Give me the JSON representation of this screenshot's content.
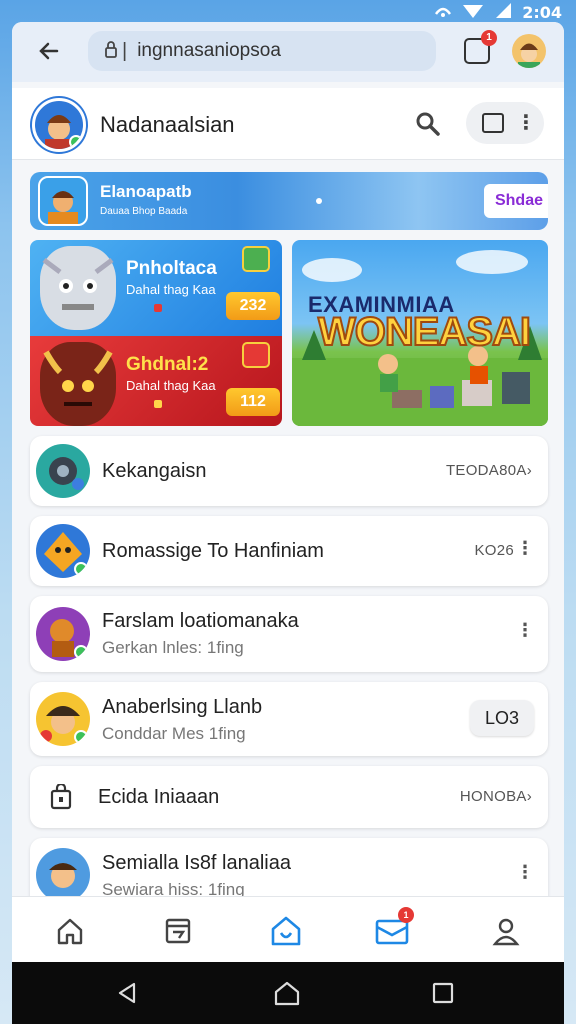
{
  "status_bar": {
    "time": "2:04"
  },
  "browser": {
    "url": "ingnnasaniopsoa",
    "tabs_badge": "1"
  },
  "header": {
    "title": "Nadanaalsian"
  },
  "promo": {
    "title": "Elanoapatb",
    "subtitle": "Dauaa Bhop Baada",
    "button": "Shdae"
  },
  "cards": [
    {
      "title": "Pnholtaca",
      "subtitle": "Dahal thag Kaa",
      "price": "232"
    },
    {
      "title": "Ghdnal:2",
      "subtitle": "Dahal thag Kaa",
      "price": "112"
    }
  ],
  "featured": {
    "title": "EXAMINMIAA",
    "word": "WONEASAI"
  },
  "list": [
    {
      "title": "Kekangaisn",
      "meta": "TEODA80A›"
    },
    {
      "title": "Romassige To Hanfiniam",
      "meta": "KO26"
    },
    {
      "title": "Farslam loatiomanaka",
      "subtitle": "Gerkan lnles: 1fing"
    },
    {
      "title": "Anaberlsing Llanb",
      "subtitle": "Conddar Mes 1fing",
      "button": "LO3"
    },
    {
      "title": "Ecida Iniaaan",
      "meta": "HONOBA›"
    },
    {
      "title": "Semialla Is8f lanaliaa",
      "subtitle": "Sewiara hiss: 1fing"
    }
  ],
  "nav_badge": "1",
  "colors": {
    "accent": "#2f78d8",
    "badge": "#e53935",
    "promo_button_text": "#8a2cd6"
  }
}
